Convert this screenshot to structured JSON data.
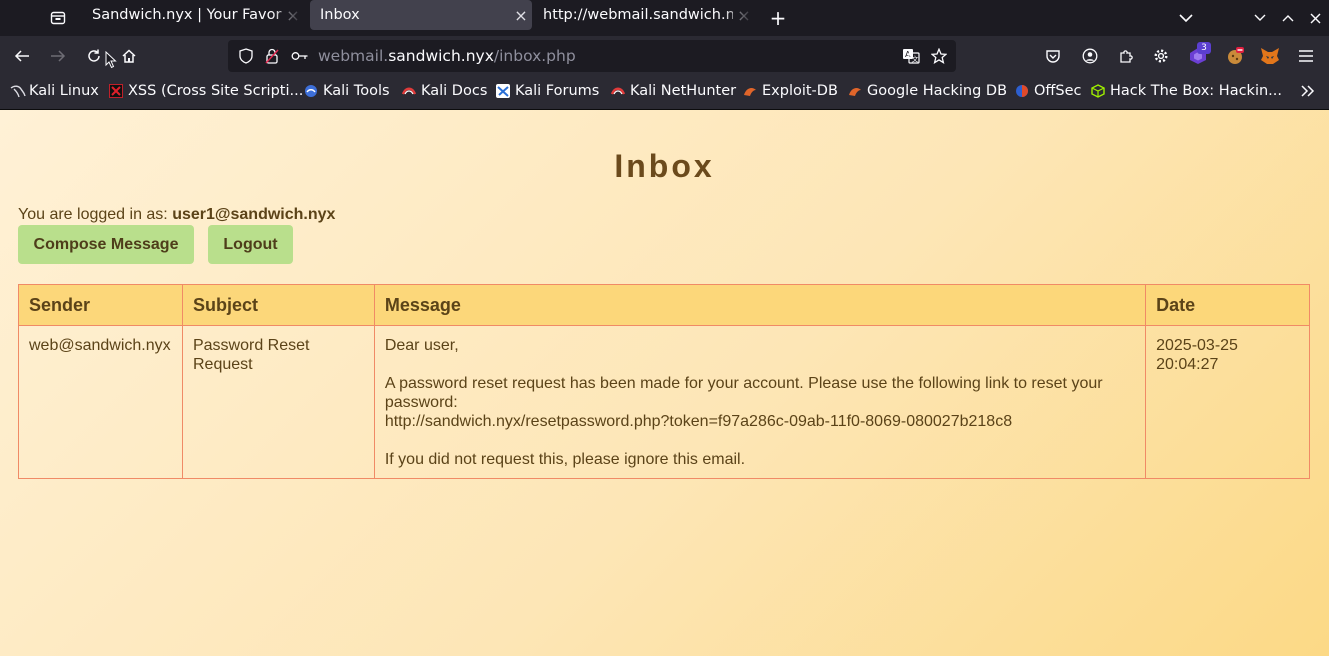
{
  "browser": {
    "tabs": [
      {
        "label": "Sandwich.nyx | Your Favorite",
        "active": false
      },
      {
        "label": "Inbox",
        "active": true
      },
      {
        "label": "http://webmail.sandwich.nyx",
        "active": false
      }
    ],
    "url": {
      "prefix": "webmail.",
      "host": "sandwich.nyx",
      "path": "/inbox.php"
    },
    "extension_badge": "3",
    "bookmarks": [
      {
        "label": "Kali Linux",
        "icon": "kali-dragon-icon"
      },
      {
        "label": "XSS (Cross Site Scripti...",
        "icon": "xss-icon"
      },
      {
        "label": "Kali Tools",
        "icon": "kali-tools-icon"
      },
      {
        "label": "Kali Docs",
        "icon": "kali-docs-icon"
      },
      {
        "label": "Kali Forums",
        "icon": "kali-forums-icon"
      },
      {
        "label": "Kali NetHunter",
        "icon": "kali-nethunter-icon"
      },
      {
        "label": "Exploit-DB",
        "icon": "exploit-db-icon"
      },
      {
        "label": "Google Hacking DB",
        "icon": "ghdb-icon"
      },
      {
        "label": "OffSec",
        "icon": "offsec-icon"
      },
      {
        "label": "Hack The Box: Hackin...",
        "icon": "htb-icon"
      }
    ]
  },
  "page": {
    "title": "Inbox",
    "logged_in_prefix": "You are logged in as:",
    "user": "user1@sandwich.nyx",
    "compose_label": "Compose Message",
    "logout_label": "Logout",
    "table": {
      "headers": [
        "Sender",
        "Subject",
        "Message",
        "Date"
      ],
      "rows": [
        {
          "sender": "web@sandwich.nyx",
          "subject": "Password Reset Request",
          "message": {
            "greeting": "Dear user,",
            "body": "A password reset request has been made for your account. Please use the following link to reset your password:",
            "link": "http://sandwich.nyx/resetpassword.php?token=f97a286c-09ab-11f0-8069-080027b218c8",
            "footer": "If you did not request this, please ignore this email."
          },
          "date": "2025-03-25 20:04:27"
        }
      ]
    }
  },
  "colors": {
    "button_bg": "#b9df8c",
    "table_header_bg": "#fcd77a",
    "table_border": "#f08a66",
    "text_brown": "#5b4318"
  }
}
